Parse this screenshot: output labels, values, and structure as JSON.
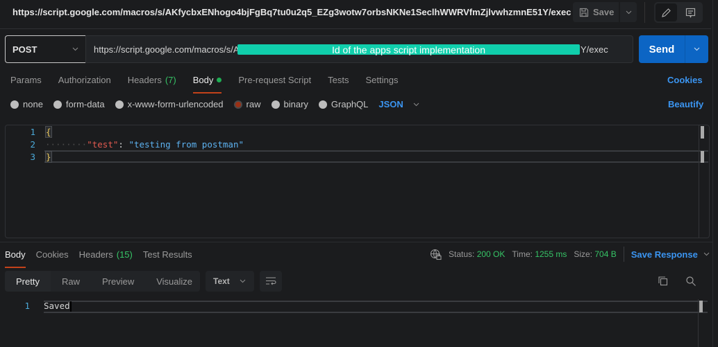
{
  "title_bar": {
    "url": "https://script.google.com/macros/s/AKfycbxENhogo4bjFgBq7tu0u2q5_EZg3wotw7orbsNKNe1SeclhWWRVfmZjlvwhzmnE51Y/exec",
    "save_label": "Save",
    "icons": {
      "save": "floppy-disk-icon",
      "edit": "pencil-icon",
      "comments": "comment-icon"
    }
  },
  "request": {
    "method": "POST",
    "url_prefix": "https://script.google.com/macros/s/A",
    "url_redaction_label": "Id of the apps script implementation",
    "url_suffix": "Y/exec",
    "send_label": "Send",
    "redaction_color": "#10cfac",
    "accent_color": "#0c65c4"
  },
  "request_tabs": [
    {
      "label": "Params",
      "count": null,
      "active": false
    },
    {
      "label": "Authorization",
      "count": null,
      "active": false
    },
    {
      "label": "Headers",
      "count": "(7)",
      "active": false
    },
    {
      "label": "Body",
      "count": null,
      "active": true,
      "indicator": "green-dot"
    },
    {
      "label": "Pre-request Script",
      "count": null,
      "active": false
    },
    {
      "label": "Tests",
      "count": null,
      "active": false
    },
    {
      "label": "Settings",
      "count": null,
      "active": false
    }
  ],
  "cookies_label": "Cookies",
  "body_types": [
    {
      "label": "none",
      "checked": false
    },
    {
      "label": "form-data",
      "checked": false
    },
    {
      "label": "x-www-form-urlencoded",
      "checked": false
    },
    {
      "label": "raw",
      "checked": true
    },
    {
      "label": "binary",
      "checked": false
    },
    {
      "label": "GraphQL",
      "checked": false
    }
  ],
  "raw_format": "JSON",
  "beautify_label": "Beautify",
  "request_body": {
    "lines": [
      {
        "num": "1",
        "open": "{"
      },
      {
        "num": "2",
        "key": "\"test\"",
        "colon": ": ",
        "value": "\"testing from postman\""
      },
      {
        "num": "3",
        "close": "}"
      }
    ]
  },
  "response": {
    "tabs": [
      {
        "label": "Body",
        "count": null,
        "active": true
      },
      {
        "label": "Cookies",
        "count": null,
        "active": false
      },
      {
        "label": "Headers",
        "count": "(15)",
        "active": false
      },
      {
        "label": "Test Results",
        "count": null,
        "active": false
      }
    ],
    "status_label": "Status:",
    "status_value": "200 OK",
    "time_label": "Time:",
    "time_value": "1255 ms",
    "size_label": "Size:",
    "size_value": "704 B",
    "save_response_label": "Save Response",
    "view_modes": [
      "Pretty",
      "Raw",
      "Preview",
      "Visualize"
    ],
    "active_view": "Pretty",
    "format": "Text",
    "body_lines": [
      {
        "num": "1",
        "text": "Saved"
      }
    ]
  }
}
